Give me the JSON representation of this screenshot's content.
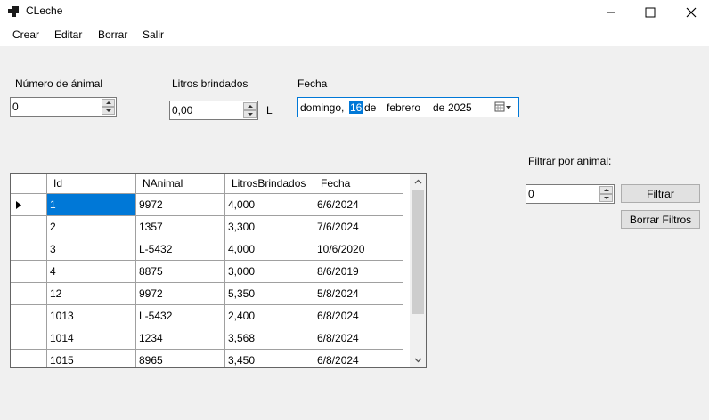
{
  "window": {
    "title": "CLeche"
  },
  "menu": [
    "Crear",
    "Editar",
    "Borrar",
    "Salir"
  ],
  "form": {
    "animal_label": "Número de ánimal",
    "animal_value": "0",
    "litros_label": "Litros brindados",
    "litros_value": "0,00",
    "litros_unit": "L",
    "fecha_label": "Fecha",
    "fecha": {
      "weekday": "domingo,",
      "day": "16",
      "de1": "de",
      "month": "febrero",
      "de2": "de",
      "year": "2025"
    }
  },
  "filter": {
    "label": "Filtrar por animal:",
    "value": "0",
    "filter_button": "Filtrar",
    "clear_button": "Borrar Filtros"
  },
  "table": {
    "columns": [
      "Id",
      "NAnimal",
      "LitrosBrindados",
      "Fecha"
    ],
    "rows": [
      [
        "1",
        "9972",
        "4,000",
        "6/6/2024"
      ],
      [
        "2",
        "1357",
        "3,300",
        "7/6/2024"
      ],
      [
        "3",
        "L-5432",
        "4,000",
        "10/6/2020"
      ],
      [
        "4",
        "8875",
        "3,000",
        "8/6/2019"
      ],
      [
        "12",
        "9972",
        "5,350",
        "5/8/2024"
      ],
      [
        "1013",
        "L-5432",
        "2,400",
        "6/8/2024"
      ],
      [
        "1014",
        "1234",
        "3,568",
        "6/8/2024"
      ],
      [
        "1015",
        "8965",
        "3,450",
        "6/8/2024"
      ]
    ],
    "selected_row": 0
  },
  "colors": {
    "accent": "#0078d7",
    "window_bg": "#f0f0f0"
  }
}
